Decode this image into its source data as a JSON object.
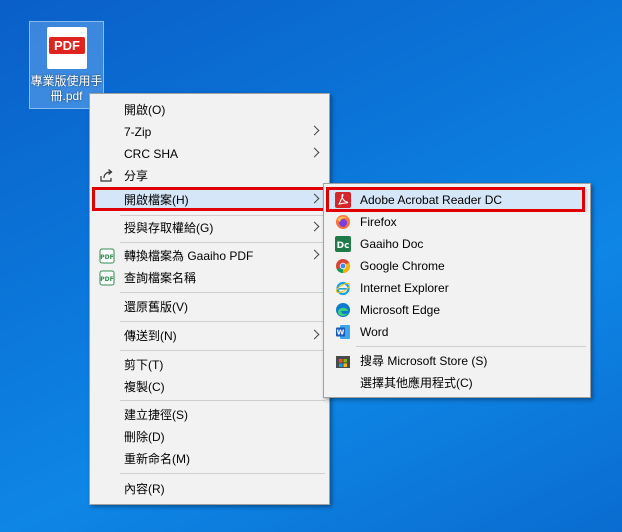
{
  "desktop": {
    "file_icon": {
      "name": "pdf-file-icon",
      "tag": "PDF",
      "label": "專業版使用手冊.pdf"
    }
  },
  "context_menu": {
    "items": [
      {
        "label": "開啟(O)",
        "bold": true
      },
      {
        "label": "7-Zip",
        "submenu": true
      },
      {
        "label": "CRC SHA",
        "submenu": true
      },
      {
        "label": "分享",
        "icon": "share-icon"
      },
      {
        "label": "開啟檔案(H)",
        "submenu": true,
        "highlighted": true
      },
      {
        "label": "授與存取權給(G)",
        "submenu": true
      },
      {
        "label": "轉換檔案為 Gaaiho PDF",
        "icon": "gaaiho-pdf-icon",
        "submenu": true
      },
      {
        "label": "查詢檔案名稱",
        "icon": "gaaiho-pdf-icon"
      },
      {
        "label": "還原舊版(V)"
      },
      {
        "label": "傳送到(N)",
        "submenu": true
      },
      {
        "label": "剪下(T)"
      },
      {
        "label": "複製(C)"
      },
      {
        "label": "建立捷徑(S)"
      },
      {
        "label": "刪除(D)"
      },
      {
        "label": "重新命名(M)"
      },
      {
        "label": "內容(R)"
      }
    ]
  },
  "open_with_menu": {
    "items": [
      {
        "label": "Adobe Acrobat Reader DC",
        "icon": "adobe-acrobat-icon",
        "highlighted": true
      },
      {
        "label": "Firefox",
        "icon": "firefox-icon"
      },
      {
        "label": "Gaaiho Doc",
        "icon": "gaaiho-doc-icon"
      },
      {
        "label": "Google Chrome",
        "icon": "chrome-icon"
      },
      {
        "label": "Internet Explorer",
        "icon": "internet-explorer-icon"
      },
      {
        "label": "Microsoft Edge",
        "icon": "edge-icon"
      },
      {
        "label": "Word",
        "icon": "word-icon"
      },
      {
        "label": "搜尋 Microsoft Store (S)",
        "icon": "microsoft-store-icon"
      },
      {
        "label": "選擇其他應用程式(C)"
      }
    ]
  },
  "colors": {
    "desktop_background": "#0b74d8",
    "highlight_border": "#e00000",
    "menu_background": "#f2f2f2"
  }
}
